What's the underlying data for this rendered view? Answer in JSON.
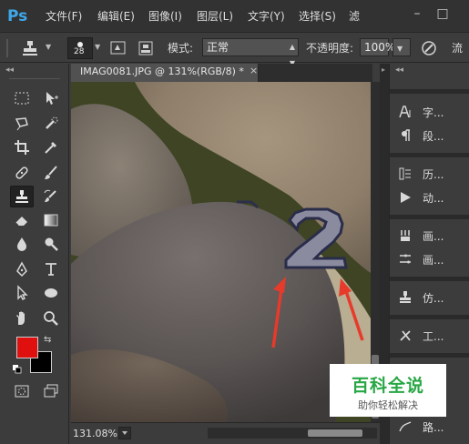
{
  "app": {
    "logo": "Ps"
  },
  "menubar": {
    "items": [
      "文件(F)",
      "编辑(E)",
      "图像(I)",
      "图层(L)",
      "文字(Y)",
      "选择(S)",
      "滤"
    ],
    "window_buttons": [
      "–",
      "□"
    ]
  },
  "options": {
    "brush_size": "28",
    "mode_label": "模式:",
    "mode_value": "正常",
    "opacity_label": "不透明度:",
    "opacity_value": "100%",
    "flow_label": "流"
  },
  "document": {
    "tab_title": "IMAG0081.JPG @ 131%(RGB/8) *",
    "close_glyph": "×",
    "zoom": "131.08%"
  },
  "canvas": {
    "overlay_text": "2",
    "left_partial": "?"
  },
  "panels": {
    "items": [
      {
        "icon": "character-icon",
        "label": "字..."
      },
      {
        "icon": "paragraph-icon",
        "label": "段..."
      },
      {
        "icon": "history-icon",
        "label": "历..."
      },
      {
        "icon": "actions-icon",
        "label": "动..."
      },
      {
        "icon": "brush-panel-icon",
        "label": "画..."
      },
      {
        "icon": "brush-presets-icon",
        "label": "画..."
      },
      {
        "icon": "clone-source-icon",
        "label": "仿..."
      },
      {
        "icon": "tool-presets-icon",
        "label": "工..."
      },
      {
        "icon": "path-icon",
        "label": "路..."
      }
    ]
  },
  "watermark": {
    "title": "百科全说",
    "subtitle": "助你轻松解决"
  },
  "colors": {
    "foreground": "#e0100e",
    "background": "#000000",
    "accent": "#3ea8e8"
  }
}
